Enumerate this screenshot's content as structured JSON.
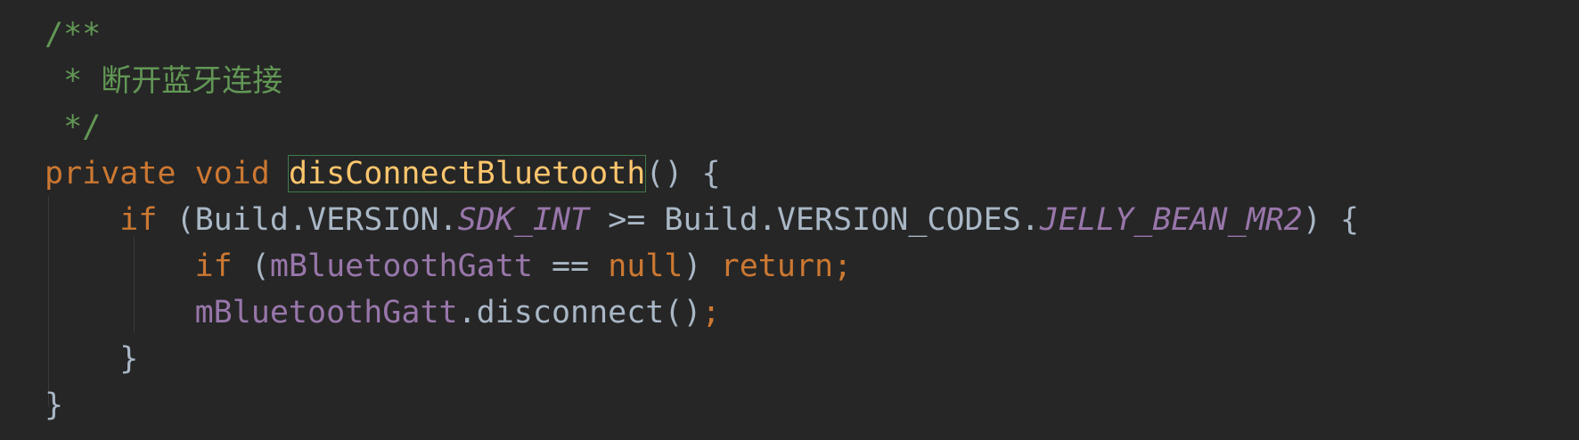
{
  "editor": {
    "theme_colors": {
      "background": "#262626",
      "comment": "#629755",
      "keyword": "#cc7832",
      "function": "#ffc66d",
      "text": "#a9b7c6",
      "field": "#9876aa"
    },
    "lines": [
      {
        "comment_open": "/**"
      },
      {
        "comment_star": " * ",
        "comment_text": "断开蓝牙连接"
      },
      {
        "comment_close": " */"
      },
      {
        "kw_private": "private",
        "sp1": " ",
        "kw_void": "void",
        "sp2": " ",
        "method_name": "disConnectBluetooth",
        "rest": "() {"
      },
      {
        "indent": "    ",
        "kw_if": "if",
        "p1": " (Build.VERSION.",
        "const1": "SDK_INT",
        "p2": " >= Build.VERSION_CODES.",
        "const2": "JELLY_BEAN_MR2",
        "p3": ") {"
      },
      {
        "indent": "        ",
        "kw_if": "if",
        "p1": " (",
        "field": "mBluetoothGatt",
        "p2": " == ",
        "kw_null": "null",
        "p3": ") ",
        "kw_return": "return",
        "semi": ";"
      },
      {
        "indent": "        ",
        "field": "mBluetoothGatt",
        "call": ".disconnect()",
        "semi": ";"
      },
      {
        "indent": "    ",
        "brace": "}"
      },
      {
        "brace": "}"
      }
    ]
  }
}
